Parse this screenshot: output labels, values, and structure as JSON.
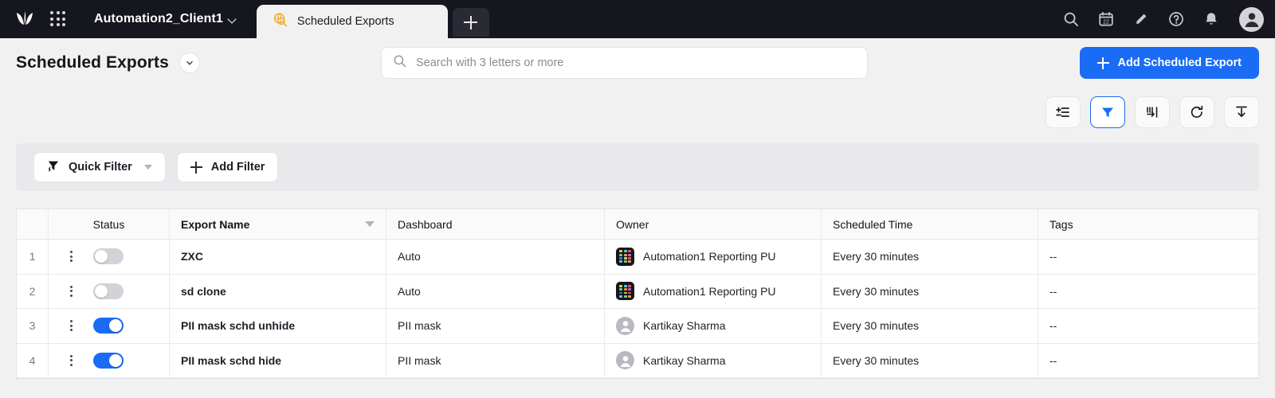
{
  "topbar": {
    "logo_icon": "leaf-logo-icon",
    "app_grid_icon": "app-grid-icon",
    "client_name": "Automation2_Client1",
    "client_caret_icon": "chevron-down-icon",
    "tabs": [
      {
        "label": "Scheduled Exports",
        "icon": "globe-search-icon",
        "active": true
      }
    ],
    "new_tab_icon": "plus-icon",
    "actions": [
      {
        "name": "search-icon"
      },
      {
        "name": "calendar-icon",
        "badge": "22"
      },
      {
        "name": "pencil-icon"
      },
      {
        "name": "help-icon"
      },
      {
        "name": "bell-icon"
      },
      {
        "name": "user-avatar-icon"
      }
    ]
  },
  "header": {
    "title": "Scheduled Exports",
    "title_caret_icon": "chevron-down-icon",
    "search": {
      "placeholder": "Search with 3 letters or more",
      "value": "",
      "icon": "search-icon"
    },
    "primary_button": {
      "label": "Add Scheduled Export",
      "icon": "plus-icon",
      "color": "#1a6cf5"
    }
  },
  "toolbar": {
    "buttons": [
      {
        "name": "column-settings-button",
        "icon": "list-settings-icon",
        "active": false
      },
      {
        "name": "filter-button",
        "icon": "filter-icon",
        "active": true
      },
      {
        "name": "pin-column-button",
        "icon": "pin-column-icon",
        "active": false
      },
      {
        "name": "refresh-button",
        "icon": "refresh-icon",
        "active": false
      },
      {
        "name": "export-button",
        "icon": "download-icon",
        "active": false
      }
    ]
  },
  "filter_bar": {
    "quick_filter": {
      "label": "Quick Filter",
      "icon": "quick-filter-icon",
      "caret_icon": "caret-down-icon"
    },
    "add_filter": {
      "label": "Add Filter",
      "icon": "plus-icon"
    }
  },
  "table": {
    "columns": [
      {
        "key": "index",
        "label": ""
      },
      {
        "key": "status",
        "label": "Status"
      },
      {
        "key": "name",
        "label": "Export Name",
        "sort_icon": "caret-down-icon"
      },
      {
        "key": "dashboard",
        "label": "Dashboard"
      },
      {
        "key": "owner",
        "label": "Owner"
      },
      {
        "key": "time",
        "label": "Scheduled Time"
      },
      {
        "key": "tags",
        "label": "Tags"
      }
    ],
    "rows": [
      {
        "index": "1",
        "enabled": false,
        "name": "ZXC",
        "dashboard": "Auto",
        "owner": "Automation1 Reporting PU",
        "owner_avatar": "app-tile-avatar",
        "time": "Every 30 minutes",
        "tags": "--"
      },
      {
        "index": "2",
        "enabled": false,
        "name": "sd clone",
        "dashboard": "Auto",
        "owner": "Automation1 Reporting PU",
        "owner_avatar": "app-tile-avatar",
        "time": "Every 30 minutes",
        "tags": "--"
      },
      {
        "index": "3",
        "enabled": true,
        "name": "PII mask schd unhide",
        "dashboard": "PII mask",
        "owner": "Kartikay Sharma",
        "owner_avatar": "person-avatar",
        "time": "Every 30 minutes",
        "tags": "--"
      },
      {
        "index": "4",
        "enabled": true,
        "name": "PII mask schd hide",
        "dashboard": "PII mask",
        "owner": "Kartikay Sharma",
        "owner_avatar": "person-avatar",
        "time": "Every 30 minutes",
        "tags": "--"
      }
    ]
  },
  "colors": {
    "accent": "#1a6cf5",
    "topbar_bg": "#16161f",
    "page_bg": "#f1f1f1",
    "tab_icon": "#f2b03c"
  }
}
